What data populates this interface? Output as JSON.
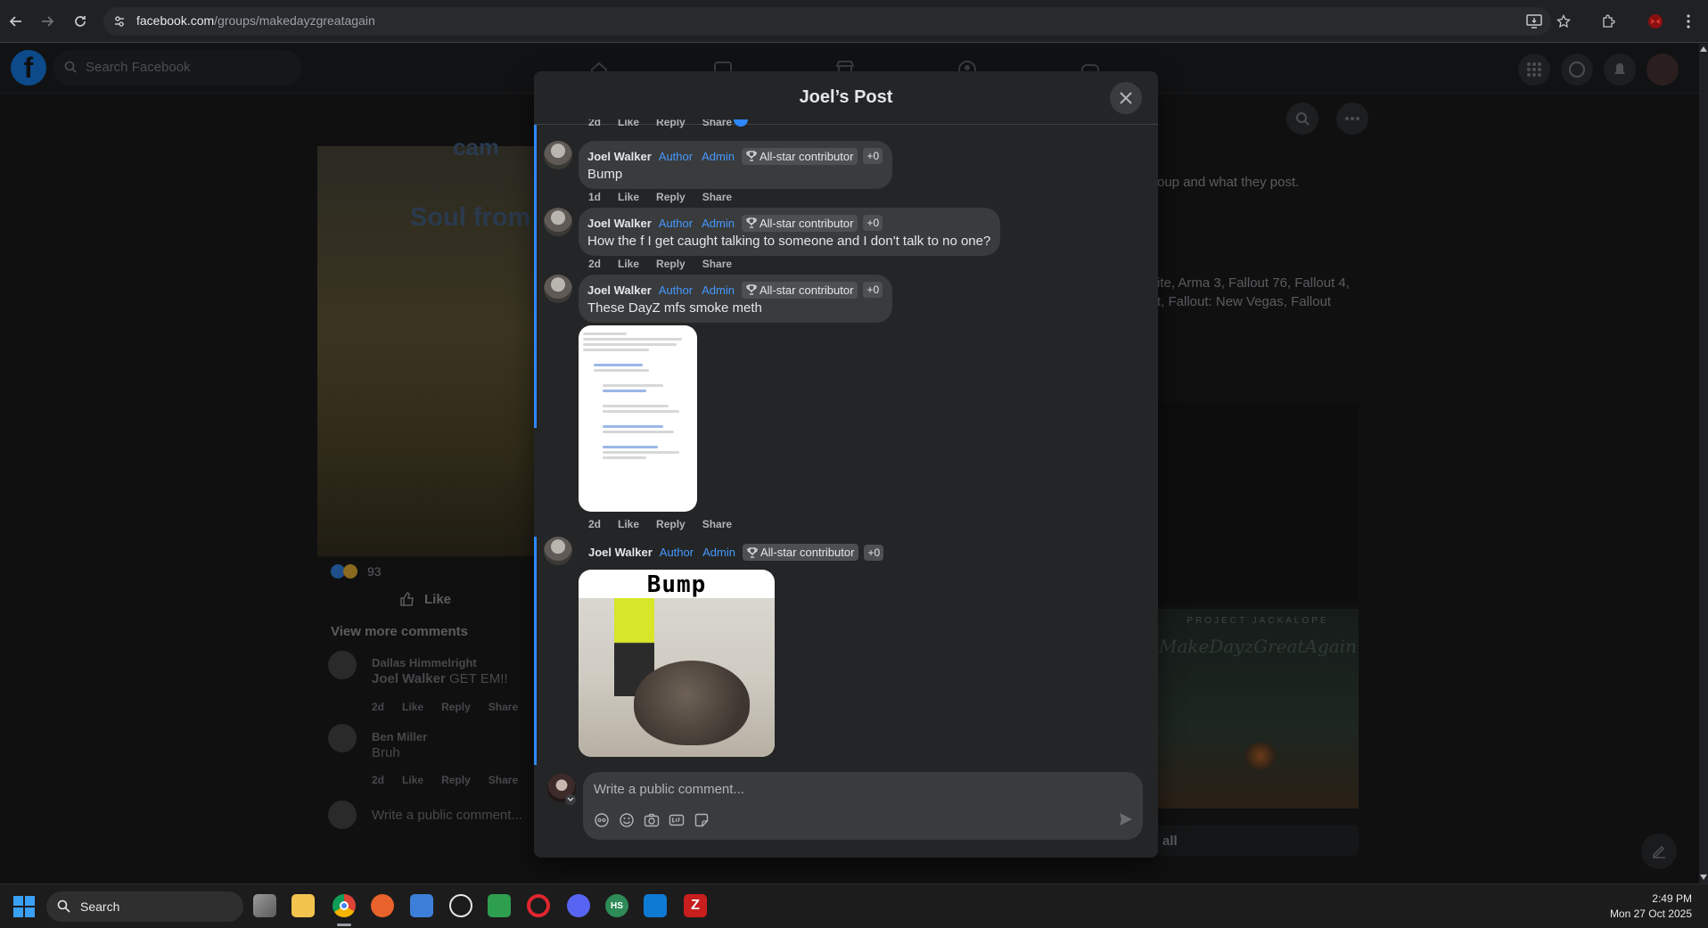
{
  "browser": {
    "url_domain": "facebook.com",
    "url_path": "/groups/makedayzgreatagain"
  },
  "facebook": {
    "search_placeholder": "Search Facebook",
    "bg_group_text": "oup and what they post.",
    "bg_games_line1": "ite, Arma 3, Fallout 76, Fallout 4,",
    "bg_games_line2": "t, Fallout: New Vegas, Fallout",
    "bg_card_title": "Soul from",
    "bg_card_caption": "cam",
    "bg_reaction_count": "93",
    "bg_like_label": "Like",
    "bg_view_more": "View more comments",
    "bg_comment1_author": "Dallas Himmelright",
    "bg_comment1_mention": "Joel Walker",
    "bg_comment1_text": "GET EM!!",
    "bg_comment2_author": "Ben Miller",
    "bg_comment2_text": "Bruh",
    "bg_actions": [
      "2d",
      "Like",
      "Reply",
      "Share"
    ],
    "bg_composer_placeholder": "Write a public comment...",
    "bg_see_all": "all",
    "bg_art_text": "PROJECT JACKALOPE",
    "bg_art_script": "MakeDayzGreatAgain"
  },
  "modal": {
    "title": "Joel’s Post",
    "top_actions": [
      "2d",
      "Like",
      "Reply",
      "Share"
    ],
    "comments": [
      {
        "author": "Joel Walker",
        "tag_author": "Author",
        "tag_admin": "Admin",
        "badge": "All-star contributor",
        "plus": "+0",
        "text": "Bump",
        "actions": [
          "1d",
          "Like",
          "Reply",
          "Share"
        ]
      },
      {
        "author": "Joel Walker",
        "tag_author": "Author",
        "tag_admin": "Admin",
        "badge": "All-star contributor",
        "plus": "+0",
        "text": "How the f I get caught talking to someone and I don't talk to no one?",
        "actions": [
          "2d",
          "Like",
          "Reply",
          "Share"
        ]
      },
      {
        "author": "Joel Walker",
        "tag_author": "Author",
        "tag_admin": "Admin",
        "badge": "All-star contributor",
        "plus": "+0",
        "text": "These DayZ mfs smoke meth",
        "actions": [
          "2d",
          "Like",
          "Reply",
          "Share"
        ]
      },
      {
        "author": "Joel Walker",
        "tag_author": "Author",
        "tag_admin": "Admin",
        "badge": "All-star contributor",
        "plus": "+0",
        "gif_text": "Bump"
      }
    ],
    "composer_placeholder": "Write a public comment..."
  },
  "taskbar": {
    "search_label": "Search",
    "time": "2:49 PM",
    "date": "Mon 27 Oct 2025"
  },
  "icons": {
    "back": "arrow-left-icon",
    "forward": "arrow-right-icon",
    "reload": "reload-icon",
    "close": "close-icon",
    "trophy": "trophy-icon",
    "send": "send-icon"
  },
  "colors": {
    "accent": "#2d88ff",
    "tag_blue": "#4599ff",
    "modal_bg": "#242526",
    "bubble_bg": "#3a3b3c"
  }
}
